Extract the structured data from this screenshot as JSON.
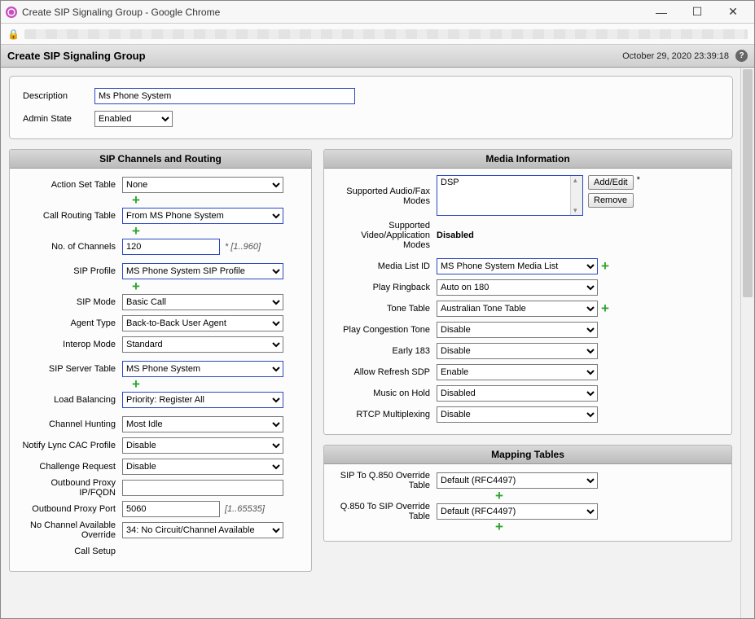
{
  "window": {
    "title": "Create SIP Signaling Group - Google Chrome"
  },
  "page": {
    "title": "Create SIP Signaling Group",
    "timestamp": "October 29, 2020 23:39:18"
  },
  "top": {
    "description_label": "Description",
    "description_value": "Ms Phone System",
    "admin_state_label": "Admin State",
    "admin_state_value": "Enabled"
  },
  "sip_panel": {
    "title": "SIP Channels and Routing",
    "action_set_table": {
      "label": "Action Set Table",
      "value": "None"
    },
    "call_routing_table": {
      "label": "Call Routing Table",
      "value": "From MS Phone System"
    },
    "no_channels": {
      "label": "No. of Channels",
      "value": "120",
      "hint": "* [1..960]"
    },
    "sip_profile": {
      "label": "SIP Profile",
      "value": "MS Phone System SIP Profile"
    },
    "sip_mode": {
      "label": "SIP Mode",
      "value": "Basic Call"
    },
    "agent_type": {
      "label": "Agent Type",
      "value": "Back-to-Back User Agent"
    },
    "interop_mode": {
      "label": "Interop Mode",
      "value": "Standard"
    },
    "sip_server_table": {
      "label": "SIP Server Table",
      "value": "MS Phone System"
    },
    "load_balancing": {
      "label": "Load Balancing",
      "value": "Priority: Register All"
    },
    "channel_hunting": {
      "label": "Channel Hunting",
      "value": "Most Idle"
    },
    "notify_lync": {
      "label": "Notify Lync CAC Profile",
      "value": "Disable"
    },
    "challenge_request": {
      "label": "Challenge Request",
      "value": "Disable"
    },
    "outbound_proxy_ip": {
      "label": "Outbound Proxy IP/FQDN",
      "value": ""
    },
    "outbound_proxy_port": {
      "label": "Outbound Proxy Port",
      "value": "5060",
      "hint": "[1..65535]"
    },
    "no_channel_override": {
      "label": "No Channel Available Override",
      "value": "34: No Circuit/Channel Available"
    },
    "call_setup": {
      "label": "Call Setup"
    }
  },
  "media_panel": {
    "title": "Media Information",
    "audio_modes": {
      "label": "Supported Audio/Fax Modes",
      "value": "DSP",
      "add": "Add/Edit",
      "remove": "Remove"
    },
    "video_modes": {
      "label": "Supported Video/Application Modes",
      "value": "Disabled"
    },
    "media_list_id": {
      "label": "Media List ID",
      "value": "MS Phone System Media List"
    },
    "play_ringback": {
      "label": "Play Ringback",
      "value": "Auto on 180"
    },
    "tone_table": {
      "label": "Tone Table",
      "value": "Australian Tone Table"
    },
    "play_congestion": {
      "label": "Play Congestion Tone",
      "value": "Disable"
    },
    "early_183": {
      "label": "Early 183",
      "value": "Disable"
    },
    "allow_refresh_sdp": {
      "label": "Allow Refresh SDP",
      "value": "Enable"
    },
    "music_on_hold": {
      "label": "Music on Hold",
      "value": "Disabled"
    },
    "rtcp_mux": {
      "label": "RTCP Multiplexing",
      "value": "Disable"
    }
  },
  "mapping_panel": {
    "title": "Mapping Tables",
    "sip_to_q850": {
      "label": "SIP To Q.850 Override Table",
      "value": "Default (RFC4497)"
    },
    "q850_to_sip": {
      "label": "Q.850 To SIP Override Table",
      "value": "Default (RFC4497)"
    }
  }
}
